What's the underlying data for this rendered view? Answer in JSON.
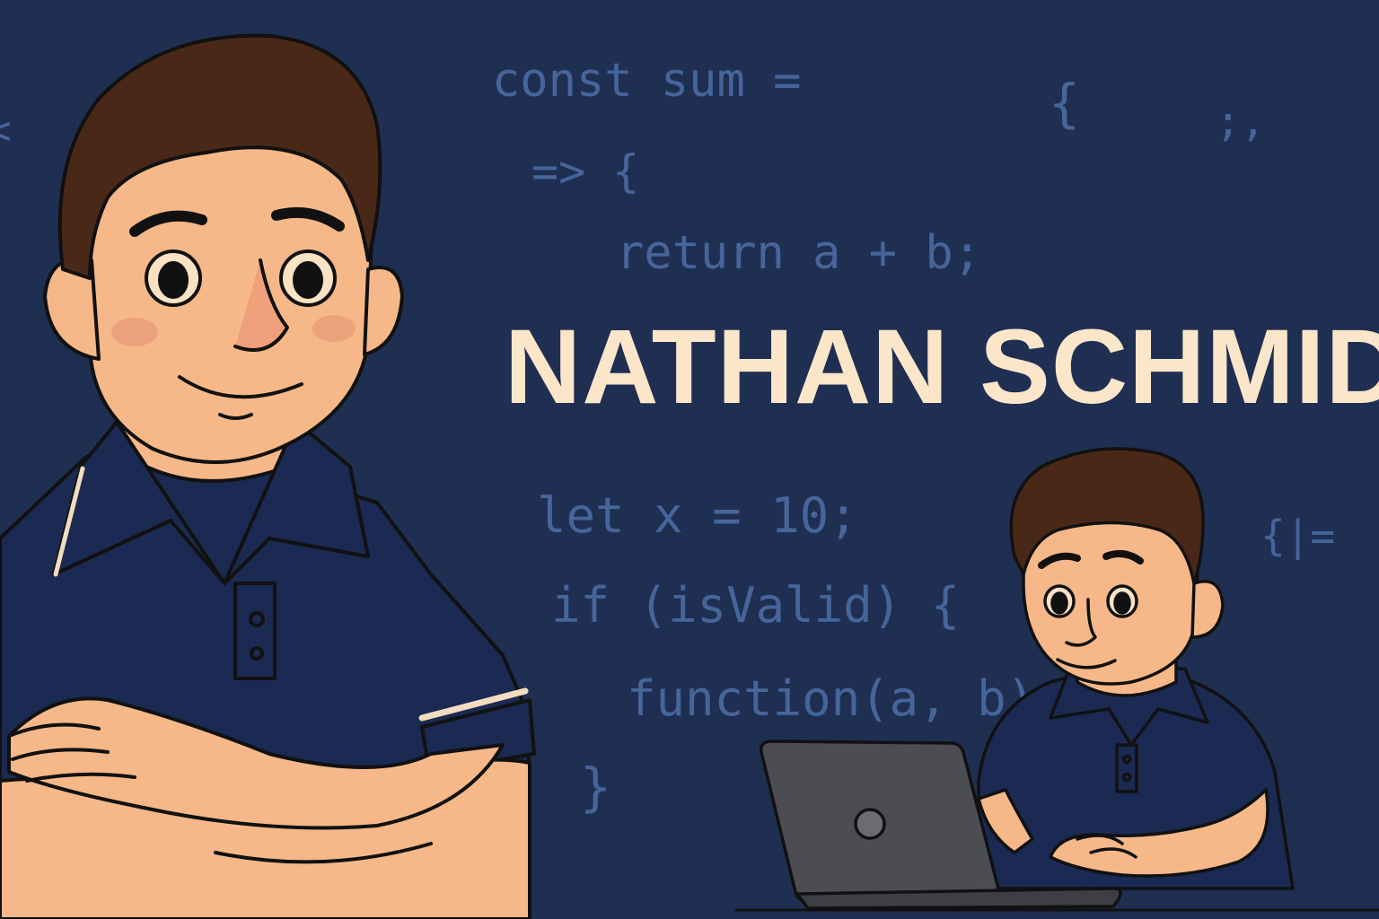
{
  "background": {
    "color": "#1f2f52",
    "code_color": "#46659a"
  },
  "code_snippets": {
    "line1": "const sum =",
    "brace_top": "{",
    "semicolon_top": ";,",
    "arrow": "=> {",
    "return_line": "return a + b;",
    "let_line": "let x = 10;",
    "right_snippet": "{|=",
    "if_line": "if (isValid) {",
    "function_line": "function(a, b)",
    "close_brace": "}",
    "edge_glyph": "<"
  },
  "title": {
    "text": "NATHAN SCHMID",
    "color": "#fbe6ca"
  },
  "illustrations": {
    "large_figure": "man-arms-crossed-illustration",
    "small_figure": "man-typing-on-laptop-illustration",
    "skin_color": "#f6b888",
    "hair_color": "#4a2818",
    "shirt_color": "#1a2a52",
    "laptop_color": "#4b4d52"
  }
}
